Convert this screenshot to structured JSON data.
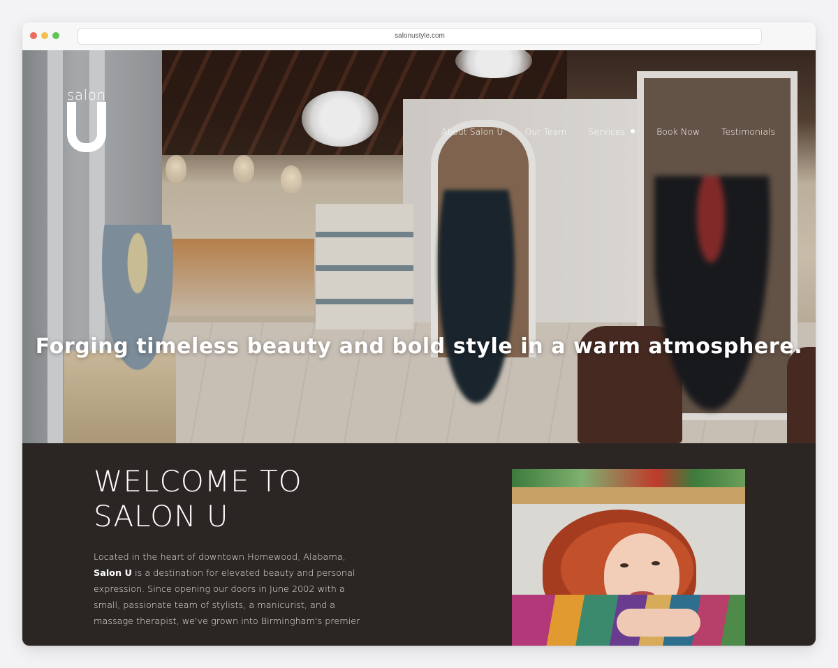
{
  "browser": {
    "url": "salonustyle.com"
  },
  "logo": {
    "word": "salon",
    "letter": "U"
  },
  "nav": {
    "items": [
      {
        "label": "About Salon U"
      },
      {
        "label": "Our Team"
      },
      {
        "label": "Services"
      },
      {
        "label": "Book Now"
      },
      {
        "label": "Testimonials"
      }
    ]
  },
  "hero": {
    "tagline": "Forging timeless beauty and bold style in a warm atmosphere."
  },
  "welcome": {
    "title_line1": "WELCOME TO",
    "title_line2": "SALON U",
    "text_before": "Located in the heart of downtown Homewood, Alabama,",
    "text_bold": "Salon U",
    "text_after": "is a destination for elevated beauty and personal expression. Since opening our doors in June 2002 with a small, passionate team of stylists, a manicurist, and a massage therapist, we've grown into Birmingham's premier"
  },
  "colors": {
    "welcome_bg": "#2b2624",
    "nav_text": "#ffffff"
  }
}
